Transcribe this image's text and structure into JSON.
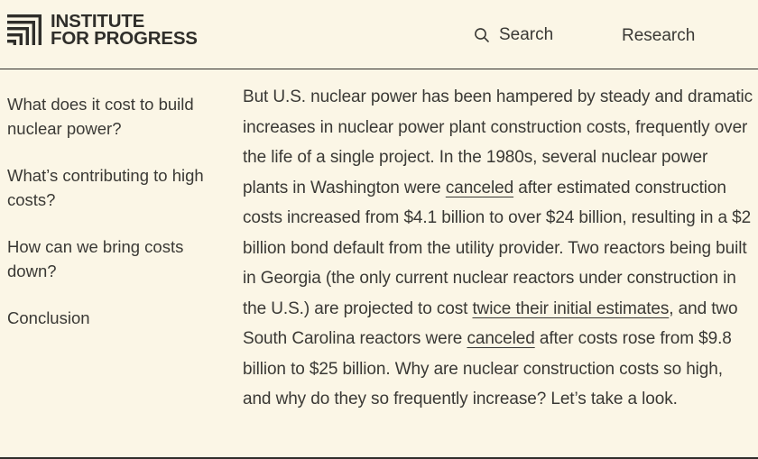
{
  "header": {
    "logo_line1": "INSTITUTE",
    "logo_line2": "FOR PROGRESS",
    "logo_icon": "bar-chart-logo-icon",
    "search_label": "Search",
    "search_icon": "search-icon",
    "research_label": "Research"
  },
  "sidebar": {
    "items": [
      {
        "label": "What does it cost to build nuclear power?"
      },
      {
        "label": "What’s contributing to high costs?"
      },
      {
        "label": "How can we bring costs down?"
      },
      {
        "label": "Conclusion"
      }
    ]
  },
  "article": {
    "p1": "But U.S. nuclear power has been hampered by steady and dramatic increases in nuclear power plant construction costs, frequently over the life of a single project. In the 1980s, several nuclear power plants in Washington were ",
    "link1": "canceled",
    "p2": " after estimated construction costs increased from $4.1 billion to over $24 billion, resulting in a $2 billion bond default from the utility provider. Two reactors being built in Georgia (the only current nuclear reactors under construction in the U.S.) are projected to cost ",
    "link2": "twice their initial estimates",
    "p3": ", and two South Carolina reactors were ",
    "link3": "canceled",
    "p4": " after costs rose from $9.8 billion to $25 billion. Why are nuclear construction costs so high, and why do they so frequently increase? Let’s take a look."
  },
  "colors": {
    "background": "#fbf6e6",
    "text": "#3a3935",
    "rule": "#2f2e2a"
  }
}
